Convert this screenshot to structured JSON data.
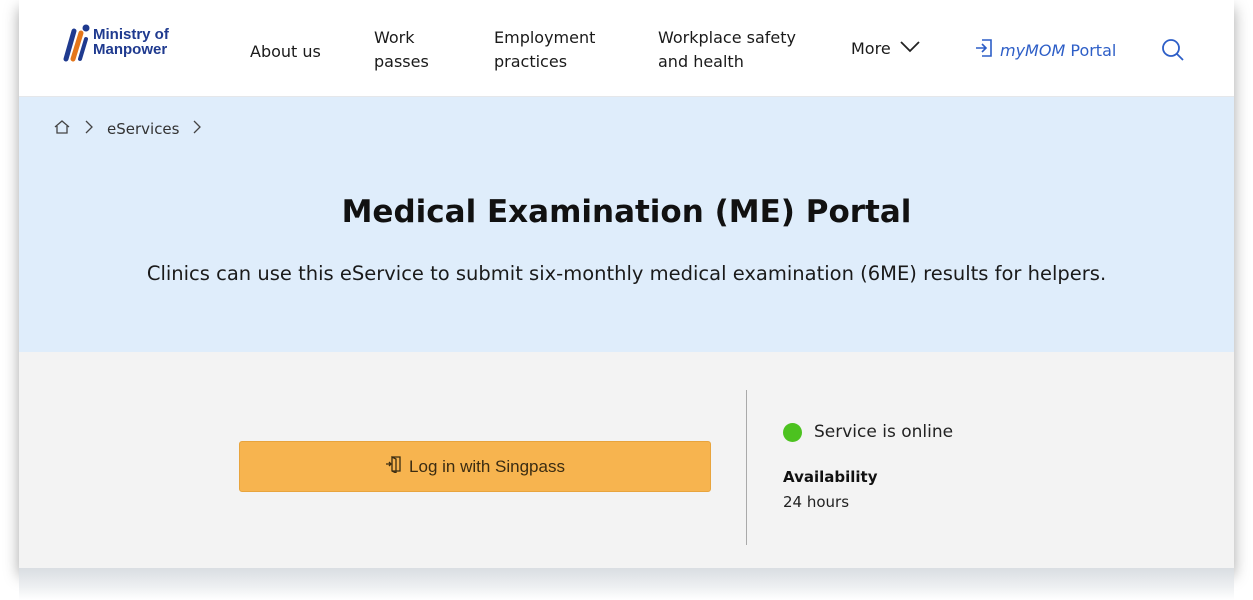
{
  "header": {
    "logo": {
      "line1": "Ministry of",
      "line2": "Manpower"
    },
    "nav": [
      {
        "line1": "About us",
        "line2": ""
      },
      {
        "line1": "Work",
        "line2": "passes"
      },
      {
        "line1": "Employment",
        "line2": "practices"
      },
      {
        "line1": "Workplace safety",
        "line2": "and health"
      }
    ],
    "more_label": "More",
    "portal": {
      "brand": "myMOM",
      "label": "Portal"
    }
  },
  "breadcrumb": {
    "items": [
      "eServices"
    ]
  },
  "hero": {
    "title": "Medical Examination (ME) Portal",
    "description": "Clinics can use this eService to submit six-monthly medical examination (6ME) results for helpers."
  },
  "service": {
    "login_label": "Log in with Singpass",
    "status_text": "Service is online",
    "availability_label": "Availability",
    "availability_value": "24 hours"
  },
  "colors": {
    "brand_blue": "#1f3a8f",
    "link_blue": "#2d5ec7",
    "hero_bg": "#dfedfb",
    "login_button": "#f7b44f",
    "status_online": "#4cc21f"
  },
  "icons": [
    "mom-logo-icon",
    "chevron-down-icon",
    "login-arrow-icon",
    "search-icon",
    "home-icon",
    "chevron-right-icon",
    "singpass-door-icon"
  ]
}
